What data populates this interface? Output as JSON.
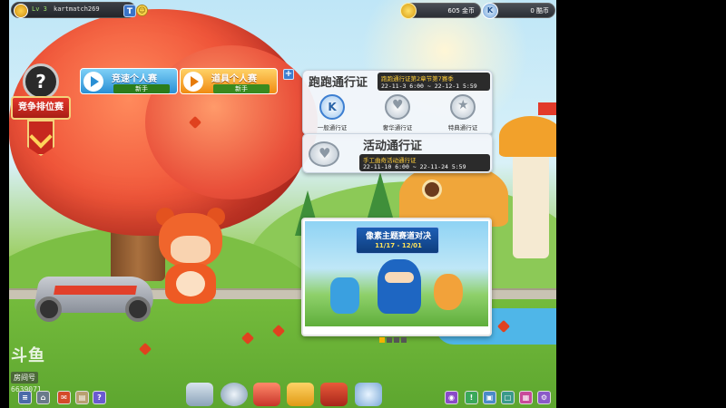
{
  "player": {
    "level": "Lv 3",
    "name": "kartmatch269"
  },
  "currency": {
    "coins": "605 金币",
    "kcoins": "0 酷币"
  },
  "ranking": {
    "icon_char": "?",
    "label": "竞争排位赛"
  },
  "modes": [
    {
      "label": "竞速个人赛",
      "tag": "新手"
    },
    {
      "label": "道具个人赛",
      "tag": "新手"
    }
  ],
  "pass": {
    "title": "跑跑通行证",
    "season_title": "跑跑通行证第2章节第7赛季",
    "season_dates": "22-11-3 6:00 ~ 22-12-1 5:59",
    "items": [
      "一般通行证",
      "奢华通行证",
      "特典通行证"
    ]
  },
  "event_pass": {
    "title": "活动通行证",
    "season_title": "手工曲奇活动通行证",
    "season_dates": "22-11-10 6:00 ~ 22-11-24 5:59"
  },
  "banner": {
    "headline": "像素主题赛道对决",
    "range": "11/17 - 12/01",
    "pages": 4,
    "active_page": 1
  },
  "watermark": {
    "logo": "斗鱼",
    "sub": "房间号",
    "number": "6639071"
  },
  "colors": {
    "accent_blue": "#2a8fd4",
    "accent_orange": "#f08a12",
    "rank_red": "#c6281e",
    "gold": "#ffcf3a"
  }
}
